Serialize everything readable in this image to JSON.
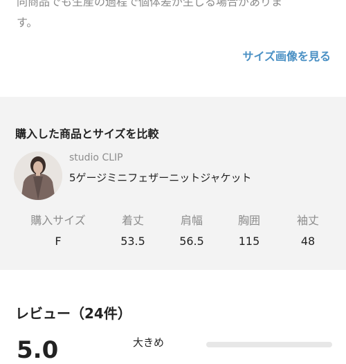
{
  "description_note": {
    "line1": "同商品でも生産の過程で個体差が生じる場合がありま",
    "line2": "す。"
  },
  "size_image_link": "サイズ画像を見る",
  "compare": {
    "title": "購入した商品とサイズを比較",
    "brand": "studio CLIP",
    "product_name": "5ゲージミニフェザーニットジャケット",
    "headers": [
      "購入サイズ",
      "着丈",
      "肩幅",
      "胸囲",
      "袖丈"
    ],
    "values": [
      "F",
      "53.5",
      "56.5",
      "115",
      "48"
    ]
  },
  "reviews": {
    "title": "レビュー（24件）",
    "rating_partial": "5.0",
    "fit_label": "大きめ"
  },
  "colors": {
    "link": "#4a90c4",
    "section_bg": "#f3f3f3",
    "muted_text": "#8d8d8d"
  }
}
